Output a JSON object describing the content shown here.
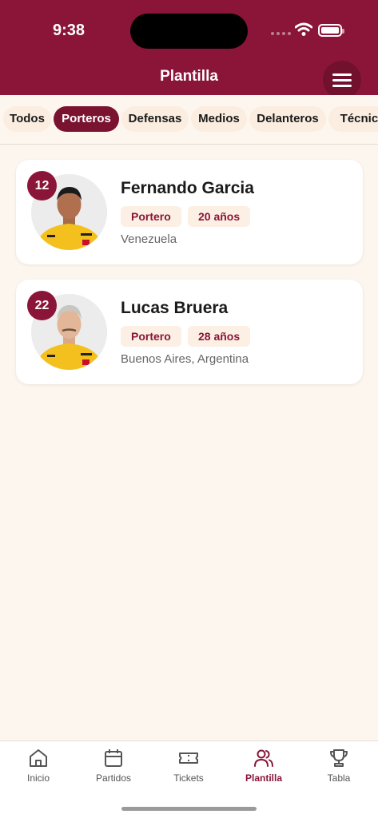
{
  "status_bar": {
    "time": "9:38"
  },
  "header": {
    "title": "Plantilla",
    "menu_icon": "hamburger-menu-icon"
  },
  "filters": [
    {
      "label": "Todos",
      "active": false
    },
    {
      "label": "Porteros",
      "active": true
    },
    {
      "label": "Defensas",
      "active": false
    },
    {
      "label": "Medios",
      "active": false
    },
    {
      "label": "Delanteros",
      "active": false
    },
    {
      "label": "Técnico",
      "active": false
    }
  ],
  "players": [
    {
      "number": "12",
      "name": "Fernando Garcia",
      "position": "Portero",
      "age": "20 años",
      "location": "Venezuela"
    },
    {
      "number": "22",
      "name": "Lucas Bruera",
      "position": "Portero",
      "age": "28 años",
      "location": "Buenos Aires, Argentina"
    }
  ],
  "tabs": [
    {
      "label": "Inicio",
      "icon": "home-icon",
      "active": false
    },
    {
      "label": "Partidos",
      "icon": "calendar-icon",
      "active": false
    },
    {
      "label": "Tickets",
      "icon": "ticket-icon",
      "active": false
    },
    {
      "label": "Plantilla",
      "icon": "users-icon",
      "active": true
    },
    {
      "label": "Tabla",
      "icon": "trophy-icon",
      "active": false
    }
  ],
  "colors": {
    "brand": "#8a1538",
    "active_chip": "#7a1330",
    "background": "#fdf6ef",
    "tag_bg": "#fcefe4",
    "jersey": "#f4c01e"
  }
}
